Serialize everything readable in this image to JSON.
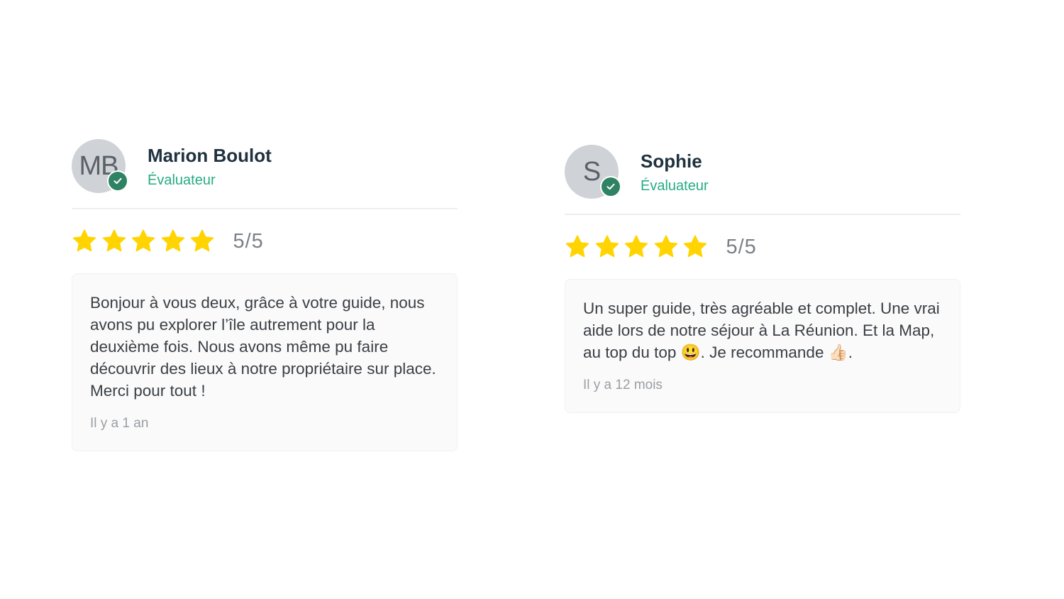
{
  "reviews": [
    {
      "initials": "MB",
      "name": "Marion Boulot",
      "role": "Évaluateur",
      "rating": 5,
      "rating_max": 5,
      "score_label": "5/5",
      "text": "Bonjour à vous deux, grâce à votre guide, nous avons pu explorer l’île autrement pour la deuxième fois. Nous avons même pu faire découvrir des lieux à notre propriétaire sur place. Merci pour tout !",
      "date": "Il y a 1 an"
    },
    {
      "initials": "S",
      "name": "Sophie",
      "role": "Évaluateur",
      "rating": 5,
      "rating_max": 5,
      "score_label": "5/5",
      "text": "Un super guide, très agréable et complet. Une vrai aide lors de notre séjour à La Réunion. Et la Map, au top du top 😃. Je recommande 👍🏻.",
      "date": "Il y a 12 mois"
    }
  ],
  "icons": {
    "verified": "check-badge-icon",
    "star": "star-icon"
  },
  "colors": {
    "star": "#FFD400",
    "verified_badge": "#2F8264",
    "role_text": "#27AB83",
    "name_text": "#20323F"
  }
}
